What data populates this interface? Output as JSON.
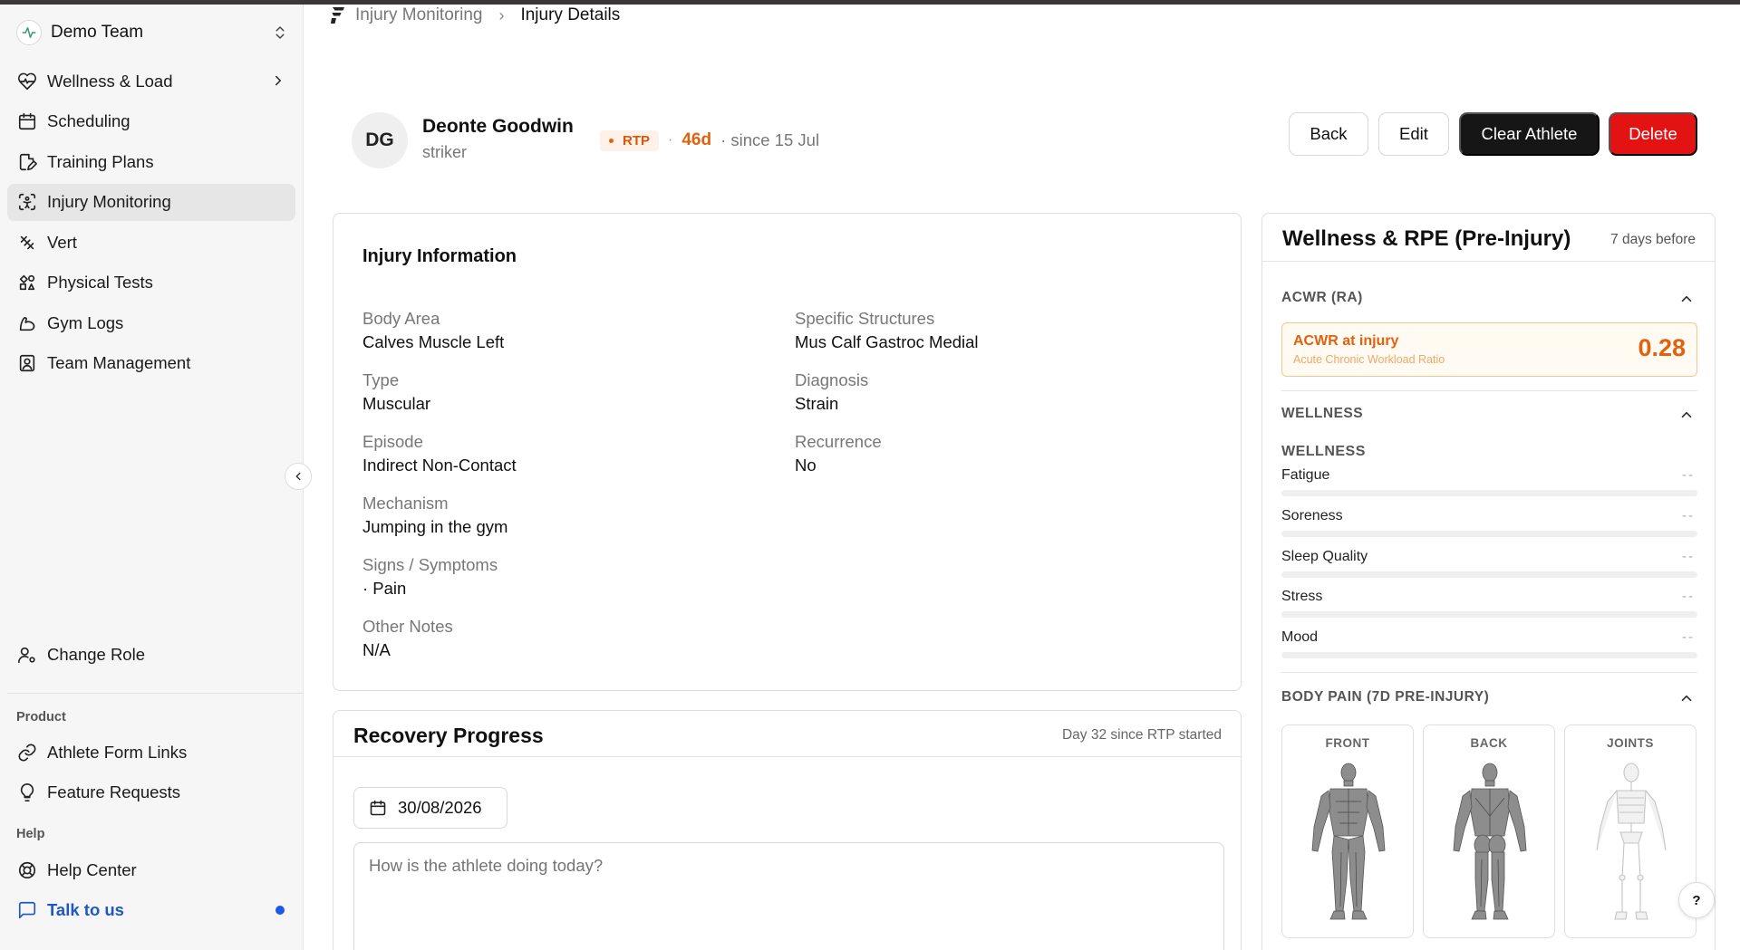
{
  "sidebar": {
    "team_name": "Demo Team",
    "nav": [
      {
        "label": "Wellness & Load"
      },
      {
        "label": "Scheduling"
      },
      {
        "label": "Training Plans"
      },
      {
        "label": "Injury Monitoring"
      },
      {
        "label": "Vert"
      },
      {
        "label": "Physical Tests"
      },
      {
        "label": "Gym Logs"
      },
      {
        "label": "Team Management"
      }
    ],
    "change_role": "Change Role",
    "product_label": "Product",
    "product_items": [
      {
        "label": "Athlete Form Links"
      },
      {
        "label": "Feature Requests"
      }
    ],
    "help_label": "Help",
    "help_items": [
      {
        "label": "Help Center"
      },
      {
        "label": "Talk to us"
      }
    ]
  },
  "breadcrumb": {
    "parent": "Injury Monitoring",
    "current": "Injury Details"
  },
  "athlete": {
    "initials": "DG",
    "name": "Deonte Goodwin",
    "position": "striker",
    "status": "RTP",
    "days": "46d",
    "since": "· since 15 Jul"
  },
  "actions": {
    "back": "Back",
    "edit": "Edit",
    "clear": "Clear Athlete",
    "delete": "Delete"
  },
  "injury": {
    "title": "Injury Information",
    "body_area_label": "Body Area",
    "body_area": "Calves Muscle Left",
    "structures_label": "Specific Structures",
    "structures": "Mus Calf Gastroc Medial",
    "type_label": "Type",
    "type": "Muscular",
    "diagnosis_label": "Diagnosis",
    "diagnosis": "Strain",
    "episode_label": "Episode",
    "episode": "Indirect Non-Contact",
    "recurrence_label": "Recurrence",
    "recurrence": "No",
    "mechanism_label": "Mechanism",
    "mechanism": "Jumping in the gym",
    "signs_label": "Signs / Symptoms",
    "signs": "· Pain",
    "notes_label": "Other Notes",
    "notes": "N/A"
  },
  "recovery": {
    "title": "Recovery Progress",
    "subtitle": "Day 32 since RTP started",
    "date": "30/08/2026",
    "placeholder": "How is the athlete doing today?"
  },
  "wellness_panel": {
    "title": "Wellness & RPE (Pre-Injury)",
    "subtitle": "7 days before",
    "acwr_section": "ACWR (RA)",
    "acwr_title": "ACWR at injury",
    "acwr_subtitle": "Acute Chronic Workload Ratio",
    "acwr_value": "0.28",
    "wellness_section": "WELLNESS",
    "wellness_sub": "WELLNESS",
    "metrics": [
      {
        "label": "Fatigue",
        "value": "--"
      },
      {
        "label": "Soreness",
        "value": "--"
      },
      {
        "label": "Sleep Quality",
        "value": "--"
      },
      {
        "label": "Stress",
        "value": "--"
      },
      {
        "label": "Mood",
        "value": "--"
      }
    ],
    "body_pain_section": "BODY PAIN (7D PRE-INJURY)",
    "views": [
      {
        "label": "FRONT"
      },
      {
        "label": "BACK"
      },
      {
        "label": "JOINTS"
      }
    ]
  },
  "help_button": "?",
  "colors": {
    "accent_orange": "#e0620e",
    "delete_red": "#e41313",
    "dark_button": "#161616",
    "link_blue": "#1f57c7"
  }
}
